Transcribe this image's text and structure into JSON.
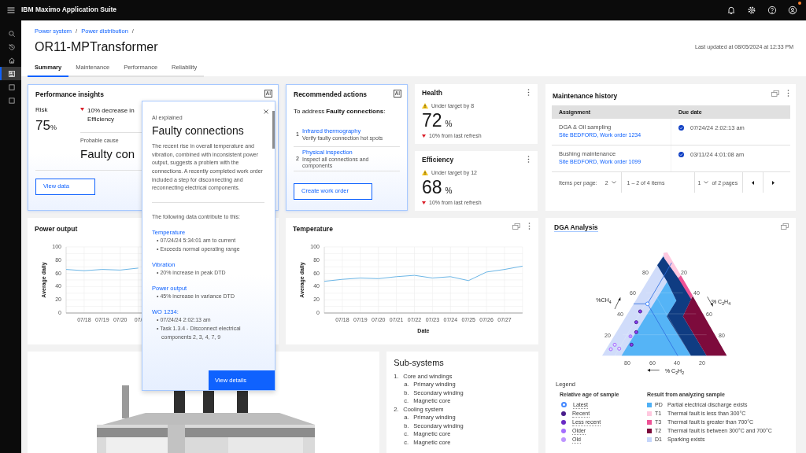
{
  "app_bar": {
    "title": "IBM Maximo Application Suite",
    "actions": [
      {
        "kind": "bell",
        "notification": false
      },
      {
        "kind": "gear",
        "notification": false
      },
      {
        "kind": "help",
        "notification": false
      },
      {
        "kind": "user",
        "notification": true
      }
    ]
  },
  "side_rail": [
    {
      "kind": "search",
      "selected": false
    },
    {
      "kind": "history",
      "selected": false
    },
    {
      "kind": "home",
      "selected": false
    },
    {
      "kind": "dashboard",
      "selected": true
    },
    {
      "kind": "square",
      "selected": false
    },
    {
      "kind": "square",
      "selected": false
    }
  ],
  "breadcrumbs": [
    {
      "label": "Power system",
      "separator": "/"
    },
    {
      "label": "Power distribution",
      "separator": "/"
    }
  ],
  "page_title": "OR11-MPTransformer",
  "last_updated": "Last updated at 08/05/2024 at 12:33 PM",
  "tabs": [
    {
      "label": "Summary",
      "selected": true
    },
    {
      "label": "Maintenance",
      "selected": false
    },
    {
      "label": "Performance",
      "selected": false
    },
    {
      "label": "Reliability",
      "selected": false
    }
  ],
  "performance_insights": {
    "title": "Performance insights",
    "ai_badge": "AI",
    "risk_label": "Risk",
    "risk_value": "75",
    "risk_unit": "%",
    "trend": "10% decrease in Efficiency",
    "cause_label": "Probable cause",
    "cause": "Faulty con",
    "button": "View data"
  },
  "recommended_actions": {
    "title": "Recommended actions",
    "ai_badge": "AI",
    "intro": "To address **Faulty connections**:",
    "items": [
      {
        "marker": "1",
        "title": "Infrared thermography",
        "description": "Verify faulty connection hot spots"
      },
      {
        "marker": "2",
        "title": "Physical inspection",
        "description": "Inspect all connections and components"
      }
    ],
    "button": "Create work order"
  },
  "kpis": [
    {
      "title": "Health",
      "status": "Under target by 8",
      "value": "72",
      "unit": "%",
      "change": "10% from last refresh"
    },
    {
      "title": "Efficiency",
      "status": "Under target by 12",
      "value": "68",
      "unit": "%",
      "change": "10% from last refresh"
    }
  ],
  "maintenance_history": {
    "title": "Maintenance history",
    "columns": [
      "Assignment",
      "Due date"
    ],
    "rows": [
      {
        "assignment": "DGA & Oil sampling",
        "link": "Site BEDFORD, Work order 1234",
        "completed": true,
        "due": "07/24/24 2:02:13 am"
      },
      {
        "assignment": "Bushing maintenance",
        "link": "Site BEDFORD, Work order 1099",
        "completed": true,
        "due": "03/11/24 4:01:08 am"
      }
    ],
    "pagination": {
      "items_per_page_label": "Items per page:",
      "items_per_page": "2",
      "range": "1 – 2 of 4 items",
      "page": "1",
      "page_total": "of 2 pages"
    }
  },
  "power_output": {
    "title": "Power output",
    "chart_data": {
      "type": "line",
      "ylabel": "Average daily",
      "categories": [
        null,
        "07/18",
        "07/19",
        "07/20",
        "07/"
      ],
      "grid": true,
      "ylim": [
        0,
        100
      ],
      "yticks": [
        0,
        20,
        40,
        60,
        80,
        100
      ],
      "series": [
        {
          "color": "#6cb6e6",
          "values": [
            66,
            64,
            66,
            65,
            68
          ]
        }
      ]
    }
  },
  "temperature": {
    "title": "Temperature",
    "chart_data": {
      "type": "line",
      "xlabel": "Date",
      "ylabel": "Average daily",
      "categories": [
        null,
        "07/18",
        "07/19",
        "07/20",
        "07/21",
        "07/22",
        "07/23",
        "07/24",
        "07/25",
        "07/26",
        "07/27",
        null
      ],
      "grid": true,
      "ylim": [
        0,
        100
      ],
      "yticks": [
        0,
        20,
        40,
        60,
        80,
        100
      ],
      "series": [
        {
          "color": "#6cb6e6",
          "values": [
            48,
            51,
            53,
            52,
            55,
            57,
            53,
            55,
            49,
            62,
            66,
            71
          ]
        }
      ]
    }
  },
  "dga_analysis": {
    "title": "DGA Analysis",
    "left_ticks": [
      "80",
      "60",
      "40",
      "20"
    ],
    "right_ticks": [
      "20",
      "40",
      "60",
      "80"
    ],
    "bottom_ticks": [
      "80",
      "60",
      "40",
      "20"
    ],
    "axis_labels": [
      "%CH$_{4}$",
      "% C$_{2}$H$_{4}$",
      "% C$_{2}$H$_{2}$"
    ],
    "legend": {
      "title": "Legend",
      "age_title": "Relative age of sample",
      "ages": [
        {
          "label": "Latest",
          "kind": "hollow",
          "color": "#4589ff"
        },
        {
          "label": "Recent",
          "kind": "filled",
          "color": "#491d8b"
        },
        {
          "label": "Less recent",
          "kind": "filled",
          "color": "#6929c4"
        },
        {
          "label": "Older",
          "kind": "filled",
          "color": "#a56eff"
        },
        {
          "label": "Old",
          "kind": "filled",
          "color": "#be95ff"
        }
      ],
      "result_title": "Result from analyzing sample",
      "results": [
        {
          "code": "PD",
          "label": "Partial electrical discharge exists",
          "color": "#4fb0f5"
        },
        {
          "code": "T1",
          "label": "Thermal fault is less than 300°C",
          "color": "#ffc8df"
        },
        {
          "code": "T3",
          "label": "Thermal fault is greater than 700°C",
          "color": "#ee5396"
        },
        {
          "code": "T2",
          "label": "Thermal fault is between 300°C and 700°C",
          "color": "#7d0b3c"
        },
        {
          "code": "D1",
          "label": "Sparking exists",
          "color": "#c6d6fb"
        }
      ]
    }
  },
  "subsystems": {
    "title": "Sub-systems",
    "items": [
      {
        "marker": "1.",
        "label": "Core and windings",
        "children": [
          {
            "marker": "a.",
            "label": "Primary winding"
          },
          {
            "marker": "b.",
            "label": "Secondary winding"
          },
          {
            "marker": "c.",
            "label": "Magnetic core"
          }
        ]
      },
      {
        "marker": "2.",
        "label": "Cooling system",
        "children": [
          {
            "marker": "a.",
            "label": "Primary winding"
          },
          {
            "marker": "b.",
            "label": "Secondary winding"
          },
          {
            "marker": "c.",
            "label": "Magnetic core"
          },
          {
            "marker": "c.",
            "label": "Magnetic core"
          }
        ]
      }
    ]
  },
  "ai_popup": {
    "eyebrow": "AI explained",
    "title": "Faulty connections",
    "body": "The recent rise in overall temperature and vibration, combined with inconsistent power output, suggests a problem with the connections.  A recently completed work order included a step for disconnecting and reconnecting electrical components.",
    "intro": "The following data contribute to this:",
    "sections": [
      {
        "heading": "Temperature",
        "points": [
          "• 07/24/24 5:34:01 am to current",
          "• Exceeds normal operating range"
        ]
      },
      {
        "heading": "Vibration",
        "points": [
          "• 20% increase in peak DTD"
        ]
      },
      {
        "heading": "Power output",
        "points": [
          "• 45% increase in variance DTD"
        ]
      },
      {
        "heading": "WO 1234:",
        "points": [
          "• 07/24/24 2:02:13 am",
          "• Task 1.3.4 - Disconnect electrical components 2, 3, 4, 7, 9"
        ]
      }
    ],
    "button": "View details"
  }
}
